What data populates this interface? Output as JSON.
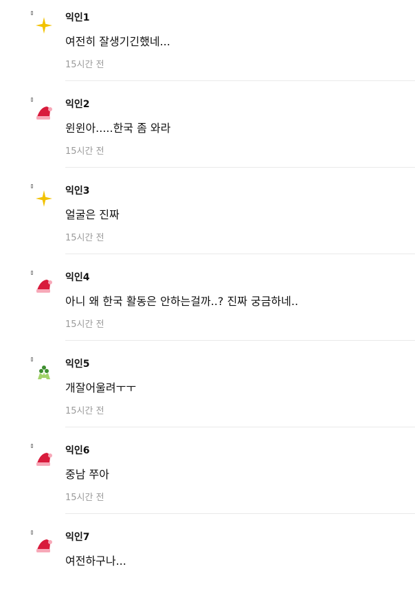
{
  "comments": [
    {
      "author": "익인1",
      "text": "여전히 잘생기긴했네...",
      "time": "15시간 전",
      "icon": "sparkle-icon"
    },
    {
      "author": "익인2",
      "text": "윈윈아.....한국 좀 와라",
      "time": "15시간 전",
      "icon": "santa-hat-icon"
    },
    {
      "author": "익인3",
      "text": "얼굴은 진짜",
      "time": "15시간 전",
      "icon": "sparkle-icon"
    },
    {
      "author": "익인4",
      "text": "아니 왜 한국 활동은 안하는걸까..? 진짜 궁금하네..",
      "time": "15시간 전",
      "icon": "santa-hat-icon"
    },
    {
      "author": "익인5",
      "text": "개잘어울려ㅜㅜ",
      "time": "15시간 전",
      "icon": "holly-icon"
    },
    {
      "author": "익인6",
      "text": "중남 쭈아",
      "time": "15시간 전",
      "icon": "santa-hat-icon"
    },
    {
      "author": "익인7",
      "text": "여전하구나...",
      "time": "",
      "icon": "santa-hat-icon"
    }
  ],
  "colors": {
    "sparkle": "#f2c200",
    "santa_hat": "#d81b3c",
    "santa_trim": "#f7a8b8",
    "holly_leaf": "#a3d36b",
    "holly_berry": "#3e8e2f"
  }
}
